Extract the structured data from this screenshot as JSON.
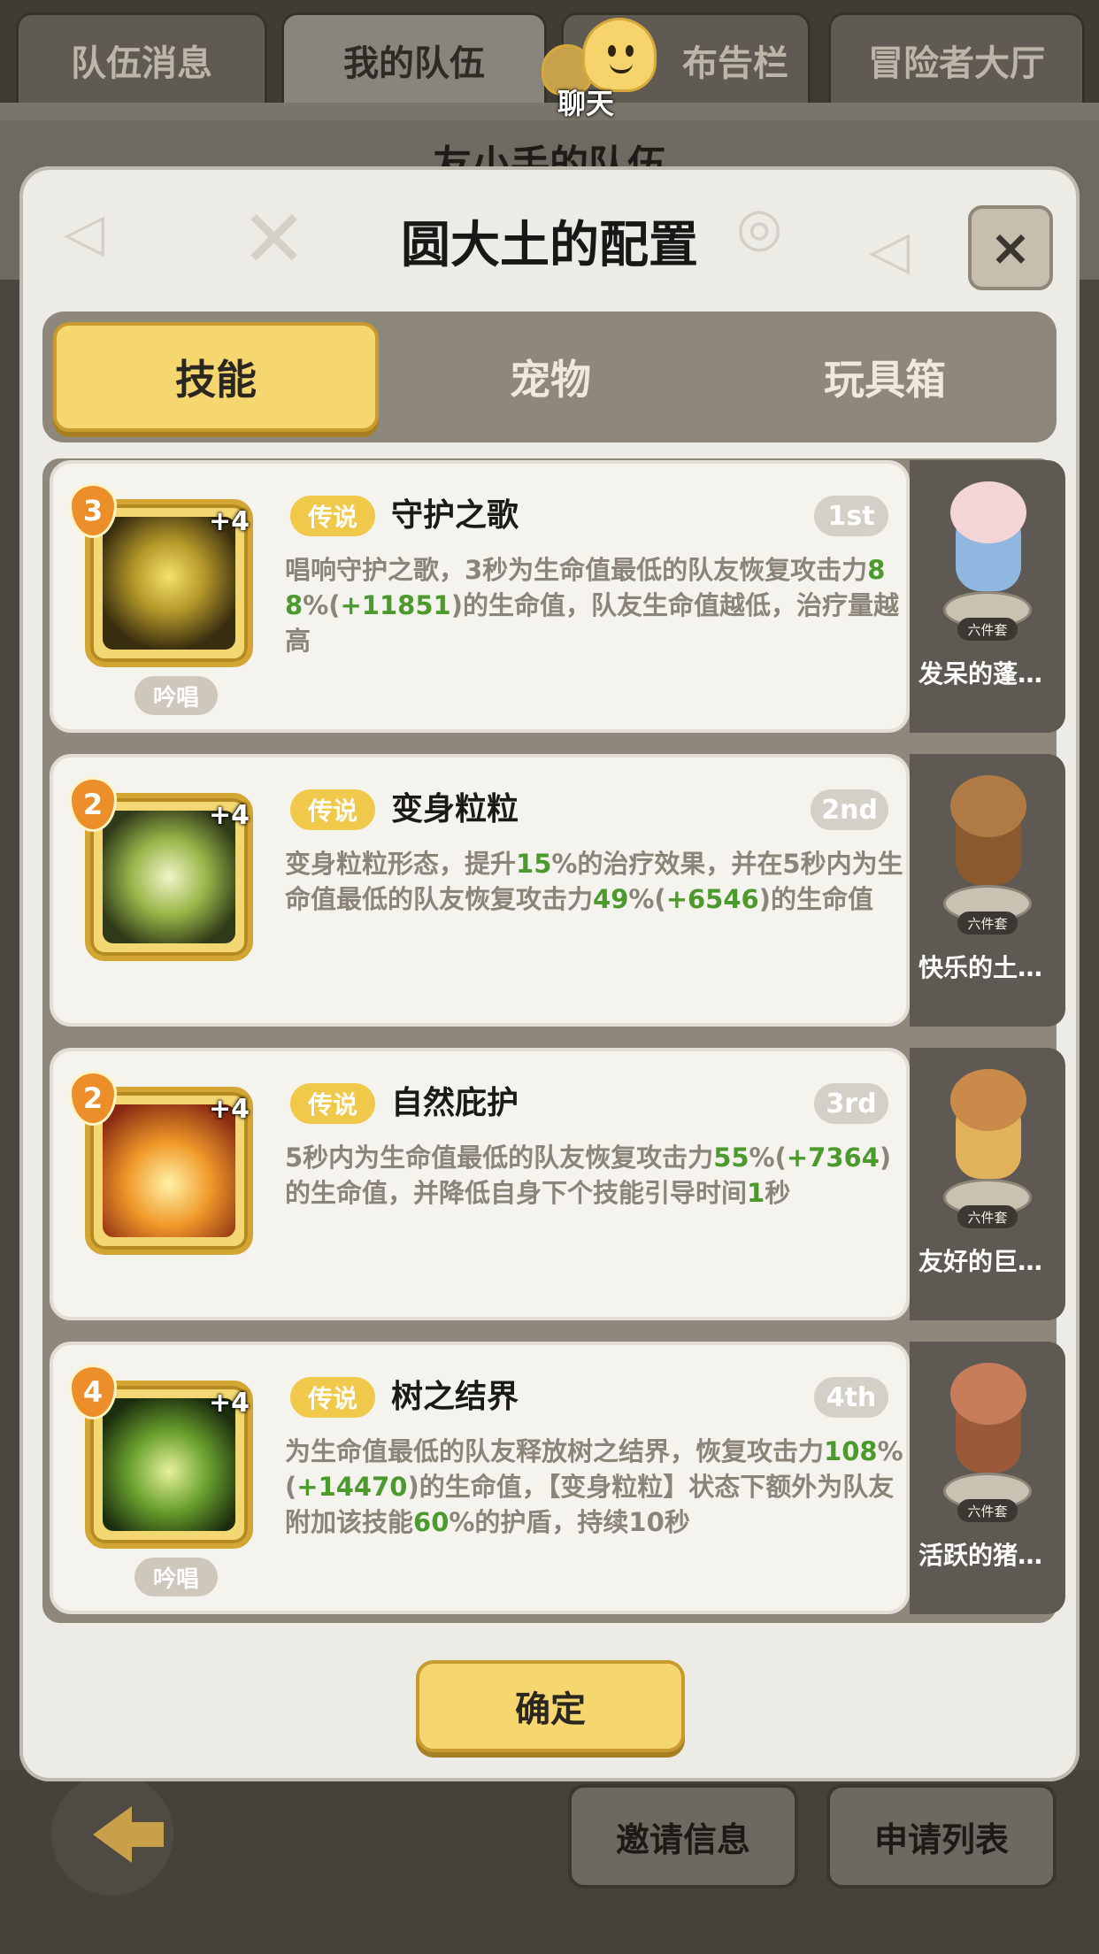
{
  "top_tabs": [
    "队伍消息",
    "我的队伍",
    "招募布告栏",
    "冒险者大厅"
  ],
  "top_tab_visible_suffix": "布告栏",
  "chat_label": "聊天",
  "behind_title": "友小手的队伍",
  "modal": {
    "title": "圆大土的配置",
    "close_symbol": "×",
    "tabs": [
      "技能",
      "宠物",
      "玩具箱"
    ],
    "active_tab": 0
  },
  "skills": [
    {
      "level": "3",
      "plus": "+4",
      "tag": "传说",
      "name": "守护之歌",
      "rank": "1st",
      "chant": "吟唱",
      "desc_parts": [
        {
          "t": "唱响守护之歌，3秒为生命值最低的队友恢复攻击力"
        },
        {
          "t": "88",
          "g": true
        },
        {
          "t": "%("
        },
        {
          "t": "+11851",
          "g": true
        },
        {
          "t": ")的生命值，队友生命值越低，治疗量越高"
        }
      ]
    },
    {
      "level": "2",
      "plus": "+4",
      "tag": "传说",
      "name": "变身粒粒",
      "rank": "2nd",
      "chant": "",
      "desc_parts": [
        {
          "t": "变身粒粒形态，提升"
        },
        {
          "t": "15",
          "g": true
        },
        {
          "t": "%的治疗效果，并在5秒内为生命值最低的队友恢复攻击力"
        },
        {
          "t": "49",
          "g": true
        },
        {
          "t": "%("
        },
        {
          "t": "+6546",
          "g": true
        },
        {
          "t": ")的生命值"
        }
      ]
    },
    {
      "level": "2",
      "plus": "+4",
      "tag": "传说",
      "name": "自然庇护",
      "rank": "3rd",
      "chant": "",
      "desc_parts": [
        {
          "t": "5秒内为生命值最低的队友恢复攻击力"
        },
        {
          "t": "55",
          "g": true
        },
        {
          "t": "%("
        },
        {
          "t": "+7364",
          "g": true
        },
        {
          "t": ")的生命值，并降低自身下个技能引导时间"
        },
        {
          "t": "1",
          "g": true
        },
        {
          "t": "秒"
        }
      ]
    },
    {
      "level": "4",
      "plus": "+4",
      "tag": "传说",
      "name": "树之结界",
      "rank": "4th",
      "chant": "吟唱",
      "desc_parts": [
        {
          "t": "为生命值最低的队友释放树之结界，恢复攻击力"
        },
        {
          "t": "108",
          "g": true
        },
        {
          "t": "%("
        },
        {
          "t": "+14470",
          "g": true
        },
        {
          "t": ")的生命值，【变身粒粒】状态下额外为队友附加该技能"
        },
        {
          "t": "60",
          "g": true
        },
        {
          "t": "%的护盾，持续10秒"
        }
      ]
    }
  ],
  "pets": [
    {
      "badge": "六件套",
      "name": "发呆的蓬…",
      "color": "#8fb7e0",
      "head": "#f3d5d8"
    },
    {
      "badge": "六件套",
      "name": "快乐的土…",
      "color": "#8a5a2e",
      "head": "#b07a44"
    },
    {
      "badge": "六件套",
      "name": "友好的巨…",
      "color": "#e0b25a",
      "head": "#c98a4a"
    },
    {
      "badge": "六件套",
      "name": "活跃的猪…",
      "color": "#9a5a3a",
      "head": "#c77d5a"
    }
  ],
  "confirm_label": "确定",
  "bottom_buttons": [
    "邀请信息",
    "申请列表"
  ],
  "colors": {
    "accent_yellow": "#f6d66e",
    "value_green": "#4c9a2e",
    "legend_tag": "#f0c94a"
  }
}
